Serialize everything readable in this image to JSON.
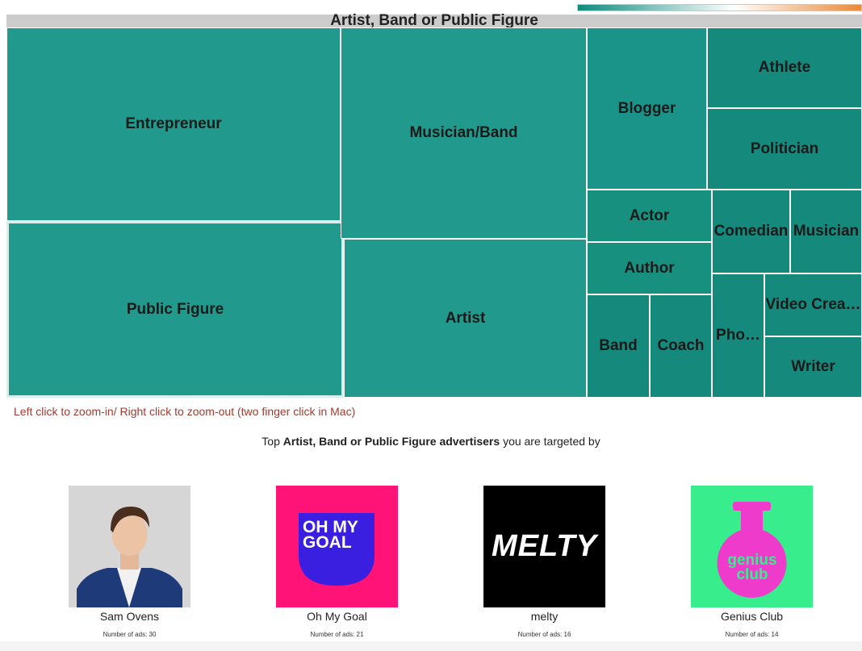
{
  "treemap": {
    "title": "Artist, Band or Public Figure",
    "cells": [
      {
        "label": "Entrepreneur"
      },
      {
        "label": "Public Figure"
      },
      {
        "label": "Musician/Band"
      },
      {
        "label": "Artist"
      },
      {
        "label": "Blogger"
      },
      {
        "label": "Athlete"
      },
      {
        "label": "Politician"
      },
      {
        "label": "Actor"
      },
      {
        "label": "Author"
      },
      {
        "label": "Comedian"
      },
      {
        "label": "Musician"
      },
      {
        "label": "Band"
      },
      {
        "label": "Coach"
      },
      {
        "label": "Pho…"
      },
      {
        "label": "Video Crea…"
      },
      {
        "label": "Writer"
      }
    ],
    "colors": {
      "teal_light": "#21998c",
      "teal_dark": "#14897c",
      "legend_start": "#0f8a7d",
      "legend_mid": "#ffffff",
      "legend_end": "#e88a3a"
    }
  },
  "hint": "Left click to zoom-in/ Right click to zoom-out (two finger click in Mac)",
  "advertisers": {
    "heading_prefix": "Top",
    "heading_bold": "Artist, Band or Public Figure advertisers",
    "heading_suffix": "you are targeted by",
    "items": [
      {
        "name": "Sam Ovens",
        "ads": "Number of ads: 30",
        "logo_text": ""
      },
      {
        "name": "Oh My Goal",
        "ads": "Number of ads: 21",
        "logo_text": "OH MY GOAL"
      },
      {
        "name": "melty",
        "ads": "Number of ads: 16",
        "logo_text": "MELTY"
      },
      {
        "name": "Genius Club",
        "ads": "Number of ads: 14",
        "logo_text": "genius club"
      }
    ]
  }
}
